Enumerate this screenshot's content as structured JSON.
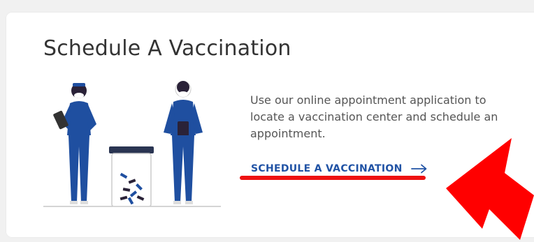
{
  "card": {
    "title": "Schedule A Vaccination",
    "description": "Use our online appointment application to locate a vaccination center and schedule an appointment.",
    "cta_label": "SCHEDULE A VACCINATION",
    "illustration": "healthcare-workers-vaccine-jar-illustration"
  },
  "annotations": {
    "underline_color": "#ee1111",
    "arrow_color": "#ff0000",
    "arrow_icon": "red-pointer-arrow-icon"
  },
  "colors": {
    "link": "#2153a5",
    "scrubs": "#1f4fa0",
    "title_text": "#333333"
  }
}
